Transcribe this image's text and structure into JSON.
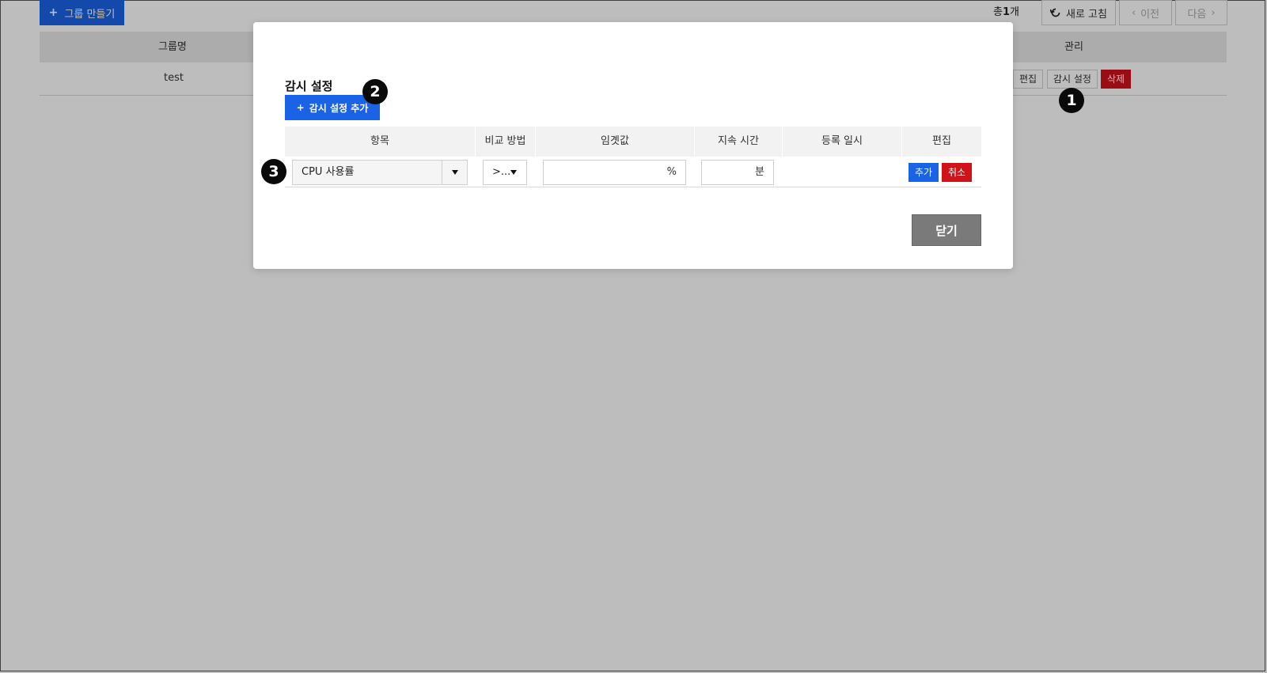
{
  "background": {
    "create_group_label": "그룹 만들기",
    "total_prefix": "총",
    "total_count": "1",
    "total_suffix": "개",
    "refresh_label": "새로 고침",
    "prev_label": "이전",
    "next_label": "다음",
    "table": {
      "headers": {
        "group_name": "그룹명",
        "manage": "관리"
      },
      "rows": [
        {
          "group_name": "test"
        }
      ],
      "row_actions": {
        "edit": "편집",
        "monitor": "감시 설정",
        "delete": "삭제"
      }
    }
  },
  "badges": [
    "1",
    "2",
    "3"
  ],
  "modal": {
    "title": "감시 설정",
    "add_button_label": "감시 설정 추가",
    "headers": [
      "항목",
      "비교 방법",
      "임곗값",
      "지속 시간",
      "등록 일시",
      "편집"
    ],
    "row": {
      "item_value": "CPU 사용률",
      "compare_value": ">...",
      "threshold_value": "",
      "threshold_unit": "%",
      "duration_value": "",
      "duration_unit": "분",
      "registered_at": "",
      "add_label": "추가",
      "cancel_label": "취소"
    },
    "close_label": "닫기"
  },
  "colors": {
    "primary": "#1a63e6",
    "danger": "#d0121b",
    "close_button": "#7a7a7a",
    "badge": "#0a0a0a"
  }
}
